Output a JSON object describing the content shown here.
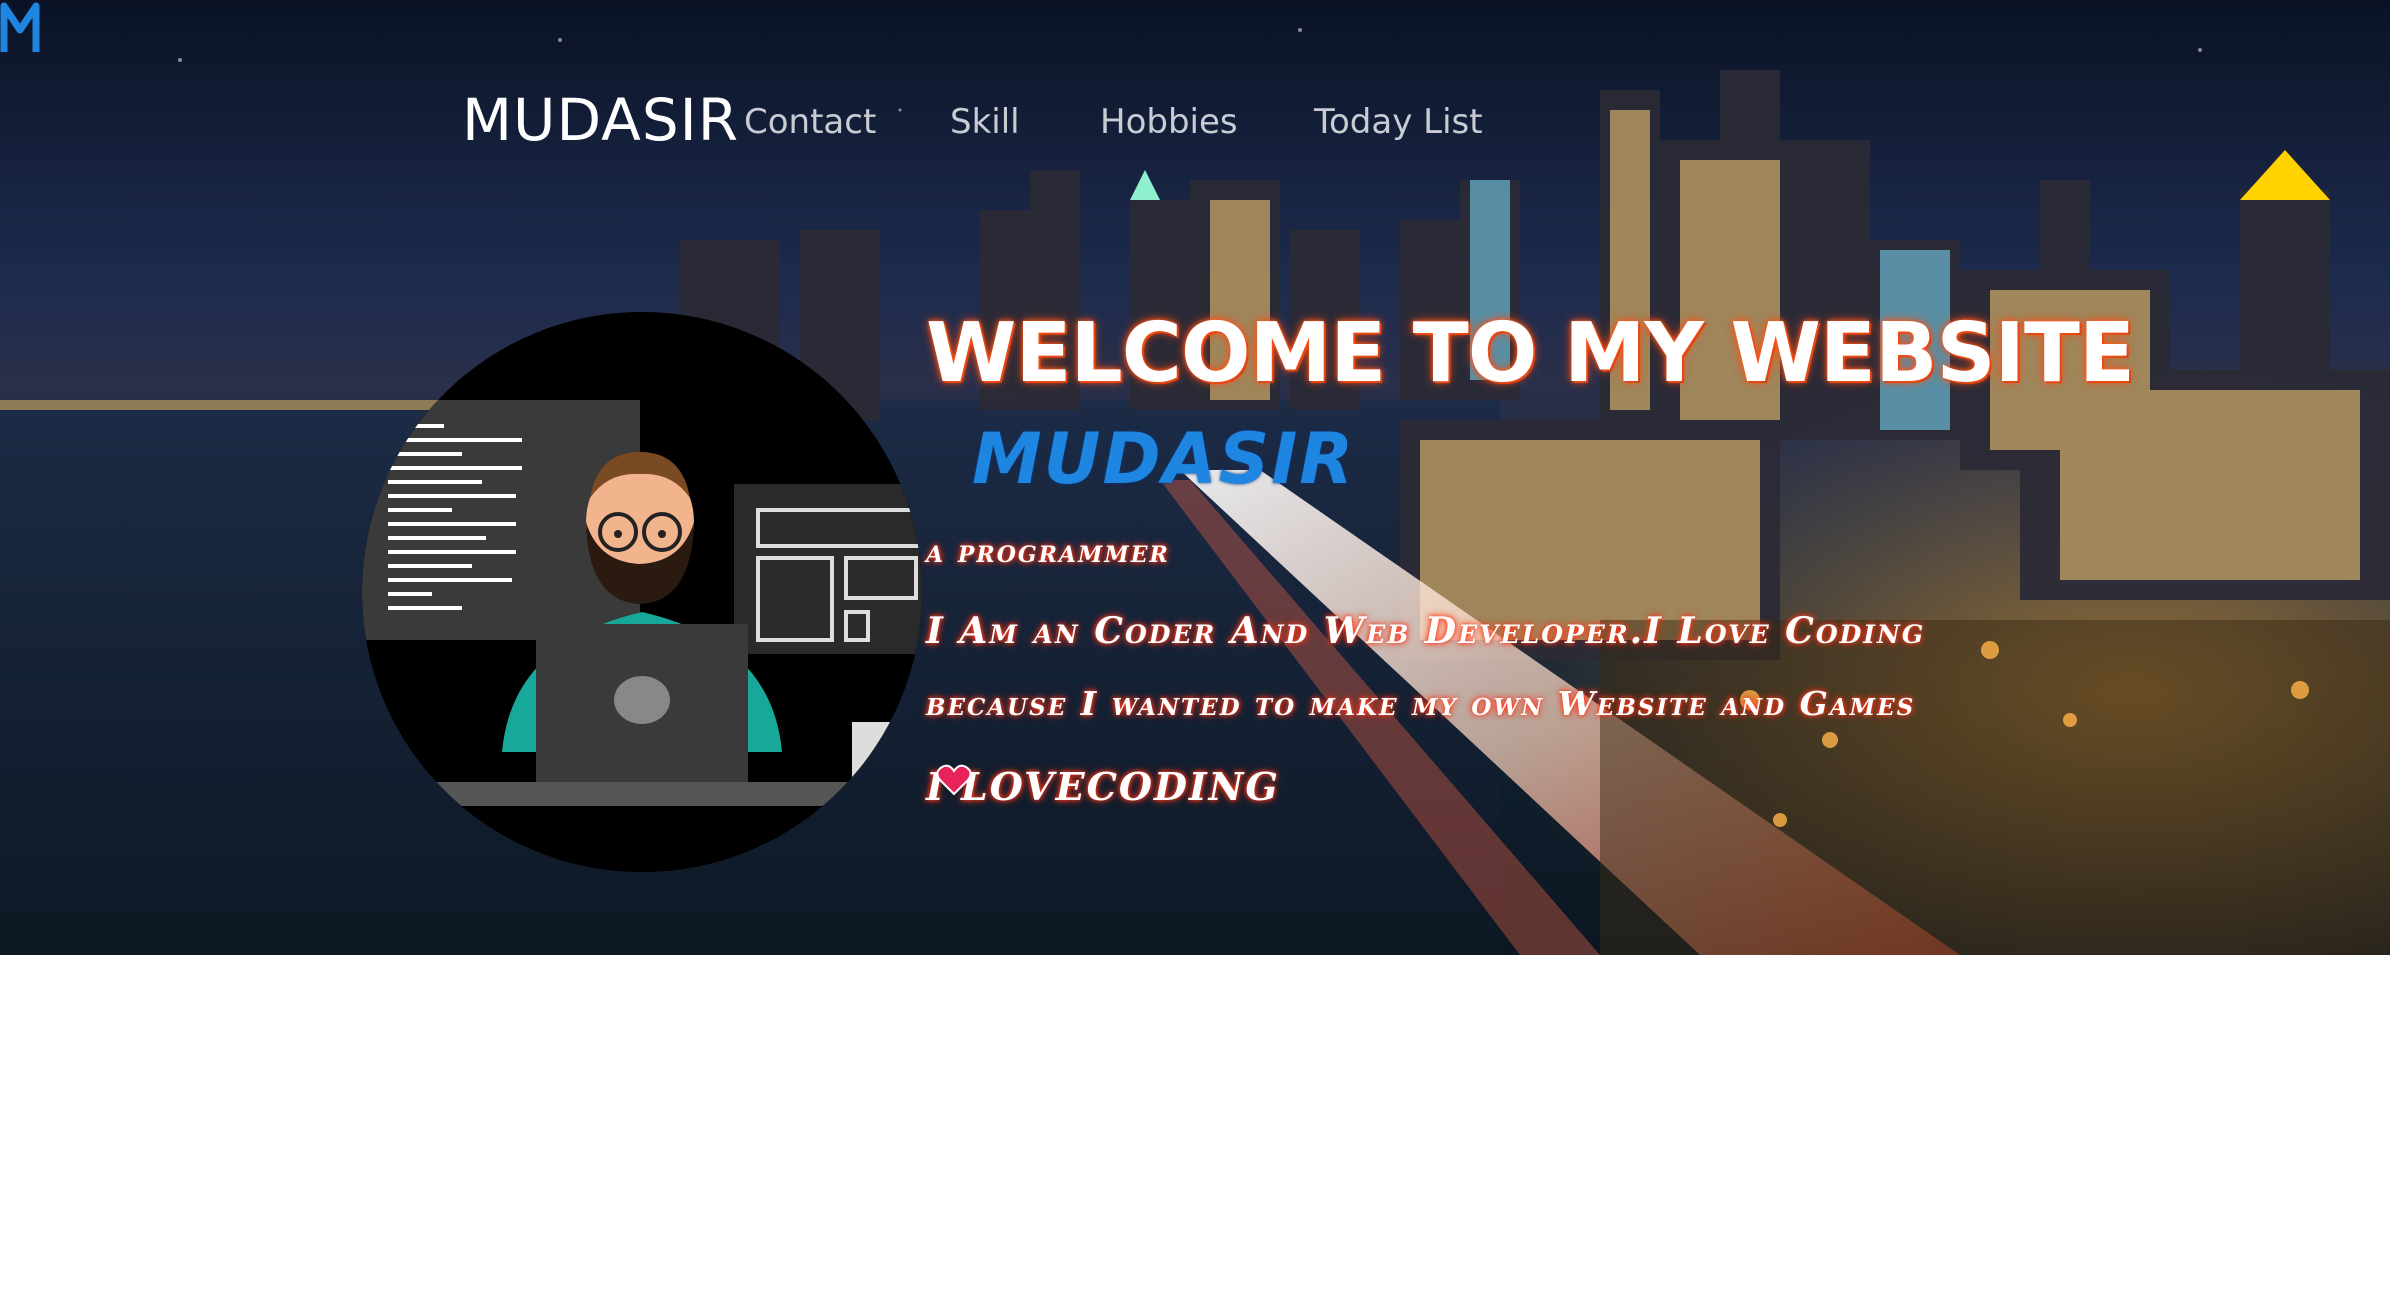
{
  "brand": {
    "logo_letter": "M",
    "name": "MUDASIR",
    "accent": "#1e86e0"
  },
  "nav": {
    "items": [
      {
        "label": "Contact"
      },
      {
        "label": "Skill"
      },
      {
        "label": "Hobbies"
      },
      {
        "label": "Today List"
      }
    ]
  },
  "hero": {
    "welcome": "WELCOME TO MY WEBSITE",
    "name": "MUDASIR",
    "line1": "a programmer",
    "line2": "I Am an Coder And Web Developer.I Love Coding",
    "line3": "because I wanted to make my own Website and Games",
    "line4_before": "I LOVE",
    "line4_after": "CODING",
    "heart_icon": "heart-icon",
    "glow_color": "#ff4a10"
  }
}
